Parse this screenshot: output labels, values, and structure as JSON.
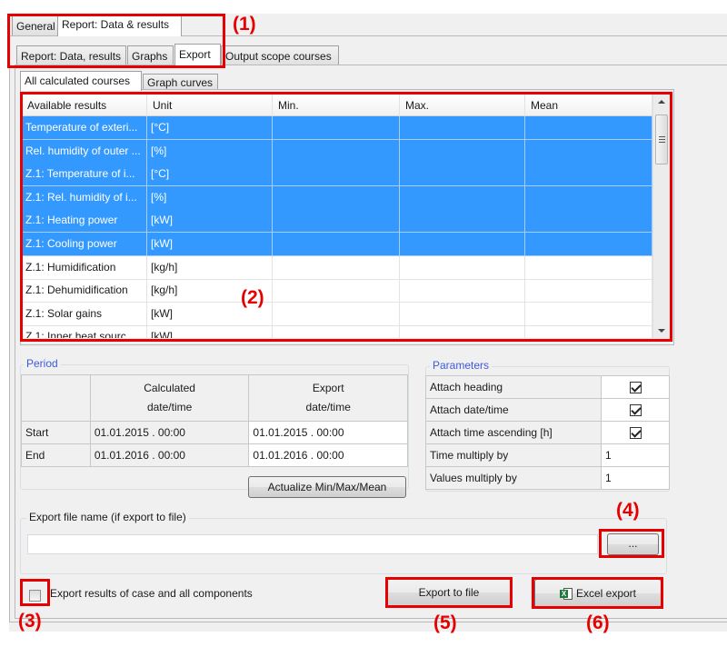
{
  "top_tabs": [
    {
      "label": "General",
      "selected": false
    },
    {
      "label": "Report: Data & results",
      "selected": true
    }
  ],
  "sub_tabs": [
    {
      "label": "Report: Data, results",
      "selected": false
    },
    {
      "label": "Graphs",
      "selected": false
    },
    {
      "label": "Export",
      "selected": true
    },
    {
      "label": "Output scope courses",
      "selected": false
    }
  ],
  "course_tabs": [
    {
      "label": "All calculated courses",
      "selected": true
    },
    {
      "label": "Graph curves",
      "selected": false
    }
  ],
  "results_grid": {
    "columns": [
      "Available results",
      "Unit",
      "Min.",
      "Max.",
      "Mean"
    ],
    "rows": [
      {
        "name": "Temperature of exteri...",
        "unit": "[°C]",
        "min": "",
        "max": "",
        "mean": "",
        "selected": true
      },
      {
        "name": "Rel. humidity of outer ...",
        "unit": "[%]",
        "min": "",
        "max": "",
        "mean": "",
        "selected": true
      },
      {
        "name": "Z.1: Temperature of i...",
        "unit": "[°C]",
        "min": "",
        "max": "",
        "mean": "",
        "selected": true
      },
      {
        "name": "Z.1: Rel. humidity of i...",
        "unit": "[%]",
        "min": "",
        "max": "",
        "mean": "",
        "selected": true
      },
      {
        "name": "Z.1: Heating power",
        "unit": "[kW]",
        "min": "",
        "max": "",
        "mean": "",
        "selected": true
      },
      {
        "name": "Z.1: Cooling power",
        "unit": "[kW]",
        "min": "",
        "max": "",
        "mean": "",
        "selected": true
      },
      {
        "name": "Z.1: Humidification",
        "unit": "[kg/h]",
        "min": "",
        "max": "",
        "mean": "",
        "selected": false
      },
      {
        "name": "Z.1: Dehumidification",
        "unit": "[kg/h]",
        "min": "",
        "max": "",
        "mean": "",
        "selected": false
      },
      {
        "name": "Z.1: Solar gains",
        "unit": "[kW]",
        "min": "",
        "max": "",
        "mean": "",
        "selected": false
      },
      {
        "name": "Z.1: Inner heat sourc...",
        "unit": "[kW]",
        "min": "",
        "max": "",
        "mean": "",
        "selected": false
      }
    ]
  },
  "period": {
    "title": "Period",
    "col_calculated_line1": "Calculated",
    "col_calculated_line2": "date/time",
    "col_export_line1": "Export",
    "col_export_line2": "date/time",
    "rows": [
      {
        "label": "Start",
        "calculated": "01.01.2015 . 00:00",
        "export": "01.01.2015 . 00:00"
      },
      {
        "label": "End",
        "calculated": "01.01.2016 . 00:00",
        "export": "01.01.2016 . 00:00"
      }
    ],
    "actualize_button": "Actualize Min/Max/Mean"
  },
  "parameters": {
    "title": "Parameters",
    "rows": [
      {
        "label": "Attach heading",
        "type": "checkbox",
        "checked": true
      },
      {
        "label": "Attach date/time",
        "type": "checkbox",
        "checked": true
      },
      {
        "label": "Attach time ascending [h]",
        "type": "checkbox",
        "checked": true
      },
      {
        "label": "Time multiply by",
        "type": "value",
        "value": "1"
      },
      {
        "label": "Values multiply by",
        "type": "value",
        "value": "1"
      }
    ]
  },
  "export_file": {
    "title": "Export file name (if export to file)",
    "value": "",
    "browse_button": "..."
  },
  "export_all_checkbox": {
    "label": "Export results of case and all components",
    "checked": false
  },
  "buttons": {
    "export_to_file": "Export to file",
    "excel_export": "Excel export"
  },
  "annotations": [
    "(1)",
    "(2)",
    "(3)",
    "(4)",
    "(5)",
    "(6)"
  ],
  "colors": {
    "selection": "#3399ff",
    "annotation": "#e60000",
    "group_title": "#3c5ae0"
  }
}
